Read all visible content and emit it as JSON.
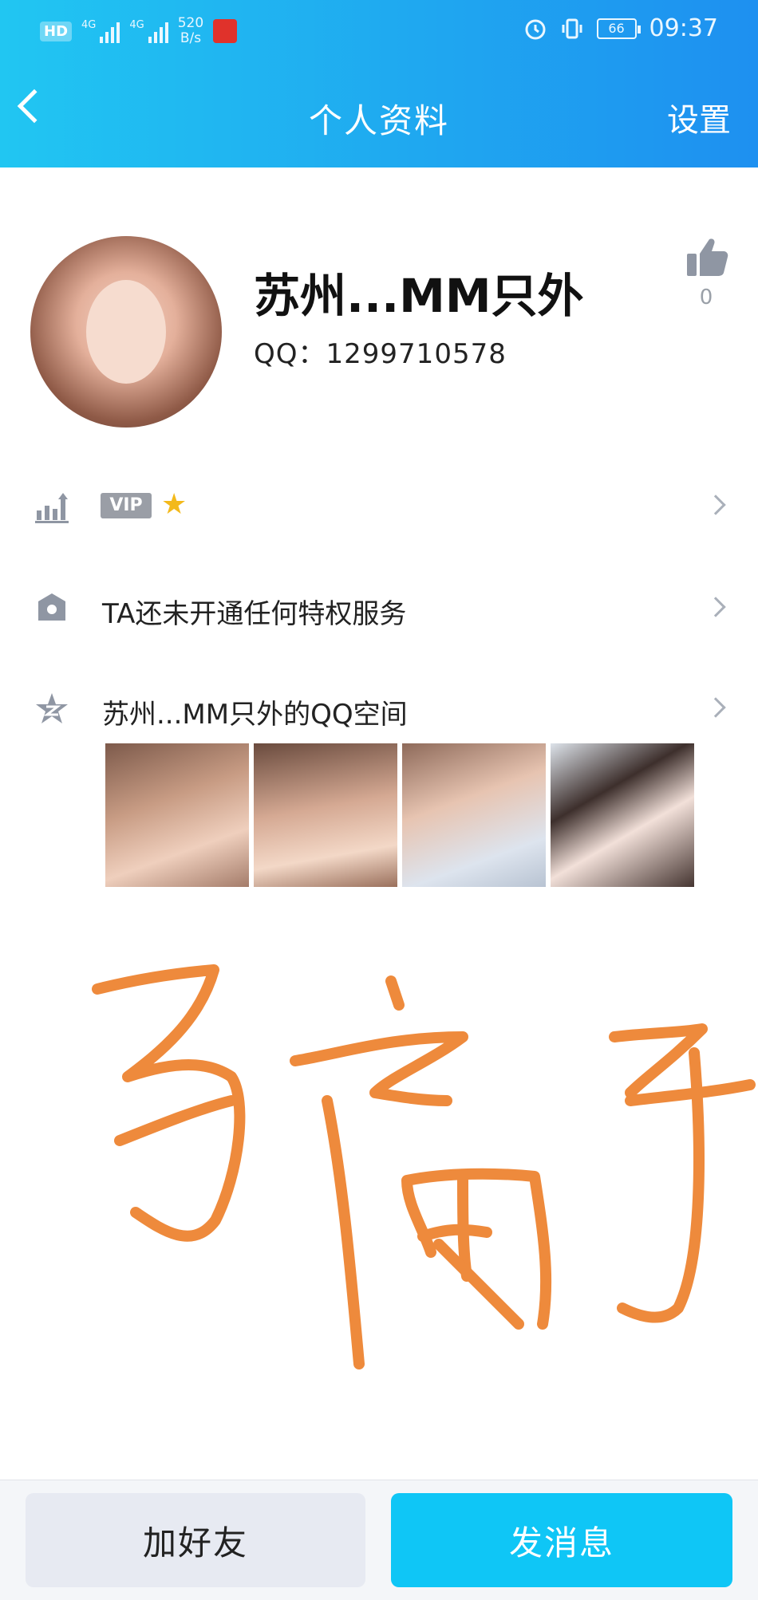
{
  "status_bar": {
    "hd_label": "HD",
    "network_label_1": "4G",
    "network_label_2": "4G",
    "speed_value": "520",
    "speed_unit": "B/s",
    "battery": "66",
    "time": "09:37"
  },
  "header": {
    "title": "个人资料",
    "settings_label": "设置"
  },
  "profile": {
    "username": "苏州...MM只外",
    "qq_line": "QQ：1299710578",
    "like_count": "0"
  },
  "rows": {
    "vip_badge": "VIP",
    "vip_star": "★",
    "privilege_text": "TA还未开通任何特权服务",
    "qzone_text": "苏州...MM只外的QQ空间"
  },
  "overlay": {
    "scribble_color": "#ee8a3c"
  },
  "buttons": {
    "add_friend": "加好友",
    "send_message": "发消息"
  },
  "colors": {
    "header_start": "#21c6f2",
    "header_end": "#1e90f0",
    "send_button": "#0fc6f6",
    "add_button": "#e7eaf2"
  },
  "icons": {
    "back": "back-chevron-icon",
    "like": "thumbs-up-icon",
    "level": "level-chart-icon",
    "privilege": "crown-badge-icon",
    "qzone": "qzone-star-icon"
  }
}
